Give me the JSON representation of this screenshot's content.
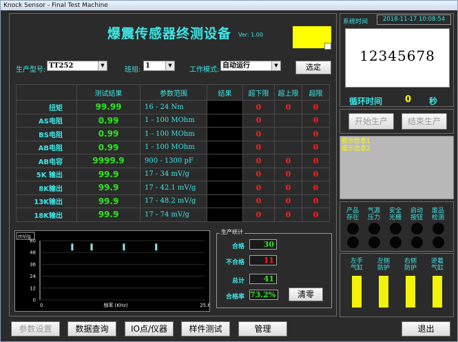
{
  "window": {
    "title": "Knock Sensor - Final Test Machine"
  },
  "header": {
    "title": "爆震传感器终测设备",
    "version": "Ver: 1.00",
    "indicator_color": "#ffff00"
  },
  "controls": {
    "model_label": "生产型号:",
    "model_value": "TT252",
    "shift_label": "班组:",
    "shift_value": "1",
    "mode_label": "工作模式:",
    "mode_value": "自动运行",
    "select_button": "选定"
  },
  "table": {
    "headers": [
      "",
      "测试结果",
      "参数范围",
      "结果",
      "超下限",
      "超上限",
      "超限"
    ],
    "rows": [
      {
        "name": "扭矩",
        "value": "99.99",
        "range": "16 - 24 Nm",
        "low": "0",
        "high": "0",
        "over": "0"
      },
      {
        "name": "AS电阻",
        "value": "0.99",
        "range": "1 - 100 MOhm",
        "low": "0",
        "high": "",
        "over": "0"
      },
      {
        "name": "BS电阻",
        "value": "0.99",
        "range": "1 - 100 MOhm",
        "low": "0",
        "high": "",
        "over": "0"
      },
      {
        "name": "AB电阻",
        "value": "0.99",
        "range": "1 - 100 MOhm",
        "low": "0",
        "high": "",
        "over": "0"
      },
      {
        "name": "AB电容",
        "value": "9999.9",
        "range": "900 - 1300 pF",
        "low": "0",
        "high": "0",
        "over": "0"
      },
      {
        "name": "5K 输出",
        "value": "99.9",
        "range": "17 - 34 mV/g",
        "low": "0",
        "high": "0",
        "over": "0"
      },
      {
        "name": "8K输出",
        "value": "99.9",
        "range": "17 - 42.1 mV/g",
        "low": "0",
        "high": "0",
        "over": "0"
      },
      {
        "name": "13K输出",
        "value": "99.9",
        "range": "17 - 48.2 mV/g",
        "low": "0",
        "high": "0",
        "over": "0"
      },
      {
        "name": "18K输出",
        "value": "99.9",
        "range": "17 - 74 mV/g",
        "low": "0",
        "high": "0",
        "over": "0"
      }
    ]
  },
  "chart_data": {
    "type": "bar",
    "xlabel": "频率 (KHz)",
    "ylabel": "mV/g",
    "xlim": [
      0,
      25.6
    ],
    "ylim": [
      0,
      60
    ],
    "y_ticks": [
      "60",
      "48",
      "36",
      "24",
      "12",
      "0"
    ],
    "x_ticks": [
      "0",
      "25.6"
    ],
    "markers": [
      {
        "x": 5.0,
        "y": 57
      },
      {
        "x": 8.0,
        "y": 57
      },
      {
        "x": 13.0,
        "y": 57
      },
      {
        "x": 18.0,
        "y": 57
      }
    ],
    "marker_color": "#8fe8f0"
  },
  "stats": {
    "title": "生产统计",
    "pass_label": "合格",
    "pass_value": "30",
    "fail_label": "不合格",
    "fail_value": "11",
    "total_label": "总计",
    "total_value": "41",
    "rate_label": "合格率",
    "rate_value": "73.2%",
    "clear_button": "清零"
  },
  "right": {
    "time_label": "系统时间",
    "time_value": "2018-11-17  10:08:54",
    "display_number": "12345678",
    "cycle_label": "循环时间",
    "cycle_value": "0",
    "cycle_unit": "秒",
    "start_button": "开始生产",
    "stop_button": "结束生产",
    "messages": [
      "提示信息1",
      "提示信息2"
    ],
    "indicators": [
      "产品存在",
      "气源压力",
      "安全光栅",
      "启动按钮",
      "废品检测"
    ],
    "bars": [
      "左手气缸",
      "左侧防护",
      "右侧防护",
      "逆着气缸"
    ]
  },
  "bottom": {
    "param_button": "参数设置",
    "query_button": "数据查询",
    "io_button": "IO点/仪器",
    "sample_button": "样件测试",
    "manage_button": "管理",
    "exit_button": "退出"
  }
}
